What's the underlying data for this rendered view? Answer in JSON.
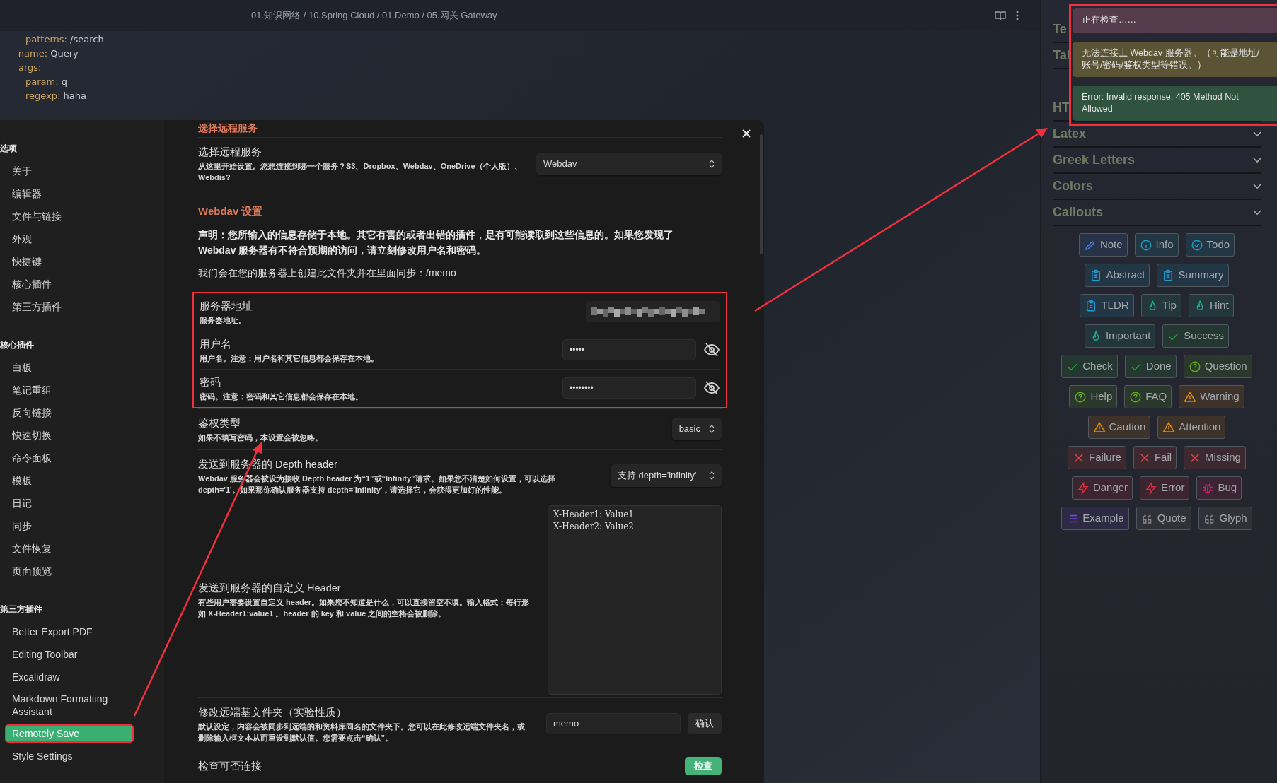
{
  "editor": {
    "breadcrumb": "01.知识网络 / 10.Spring Cloud / 01.Demo / 05.网关 Gateway",
    "code": [
      {
        "children": [
          {
            "key": "patterns:",
            "value": "/search"
          }
        ]
      },
      {
        "dash": "-",
        "key": "name:",
        "value": "Query"
      },
      {
        "key": "args:",
        "children": [
          {
            "key": "param:",
            "value": "q"
          },
          {
            "key": "regexp:",
            "value": "haha"
          }
        ]
      }
    ]
  },
  "settings_sidebar": [
    {
      "title": "选项",
      "items": [
        {
          "label": "关于",
          "selected": false,
          "highlighted": false
        },
        {
          "label": "编辑器",
          "selected": false,
          "highlighted": false
        },
        {
          "label": "文件与链接",
          "selected": false,
          "highlighted": false
        },
        {
          "label": "外观",
          "selected": false,
          "highlighted": false
        },
        {
          "label": "快捷键",
          "selected": false,
          "highlighted": false
        },
        {
          "label": "核心插件",
          "selected": false,
          "highlighted": false
        },
        {
          "label": "第三方插件",
          "selected": false,
          "highlighted": false
        }
      ]
    },
    {
      "title": "核心插件",
      "items": [
        {
          "label": "白板",
          "selected": false,
          "highlighted": false
        },
        {
          "label": "笔记重组",
          "selected": false,
          "highlighted": false
        },
        {
          "label": "反向链接",
          "selected": false,
          "highlighted": false
        },
        {
          "label": "快速切换",
          "selected": false,
          "highlighted": false
        },
        {
          "label": "命令面板",
          "selected": false,
          "highlighted": false
        },
        {
          "label": "模板",
          "selected": false,
          "highlighted": false
        },
        {
          "label": "日记",
          "selected": false,
          "highlighted": false
        },
        {
          "label": "同步",
          "selected": false,
          "highlighted": false
        },
        {
          "label": "文件恢复",
          "selected": false,
          "highlighted": false
        },
        {
          "label": "页面预览",
          "selected": false,
          "highlighted": false
        }
      ]
    },
    {
      "title": "第三方插件",
      "items": [
        {
          "label": "Better Export PDF",
          "selected": false,
          "highlighted": false
        },
        {
          "label": "Editing Toolbar",
          "selected": false,
          "highlighted": false
        },
        {
          "label": "Excalidraw",
          "selected": false,
          "highlighted": false
        },
        {
          "label": "Markdown Formatting Assistant",
          "selected": false,
          "highlighted": false
        },
        {
          "label": "Remotely Save",
          "selected": true,
          "highlighted": true
        },
        {
          "label": "Style Settings",
          "selected": false,
          "highlighted": false
        }
      ]
    }
  ],
  "settings": {
    "top_heading": "选择远程服务",
    "items": [
      {
        "kind": "setting",
        "name": "选择远程服务",
        "desc": "从这里开始设置。您想连接到哪一个服务？S3、Dropbox、Webdav、OneDrive（个人版）、Webdis?",
        "highlighted": false,
        "control": {
          "kind": "select",
          "value": "Webdav"
        }
      },
      {
        "kind": "heading",
        "text": "Webdav 设置"
      },
      {
        "kind": "paragraph",
        "bold": true,
        "text": "声明：您所输入的信息存储于本地。其它有害的或者出错的插件，是有可能读取到这些信息的。如果您发现了 Webdav 服务器有不符合预期的访问，请立刻修改用户名和密码。"
      },
      {
        "kind": "paragraph",
        "bold": false,
        "text": "我们会在您的服务器上创建此文件夹并在里面同步：/memo"
      },
      {
        "kind": "setting",
        "name": "服务器地址",
        "desc": "服务器地址。",
        "highlighted": true,
        "control": {
          "kind": "redacted"
        }
      },
      {
        "kind": "setting",
        "name": "用户名",
        "desc": "用户名。注意：用户名和其它信息都会保存在本地。",
        "highlighted": true,
        "control": {
          "kind": "password",
          "value": "•••••"
        }
      },
      {
        "kind": "setting",
        "name": "密码",
        "desc": "密码。注意：密码和其它信息都会保存在本地。",
        "highlighted": true,
        "control": {
          "kind": "password",
          "value": "••••••••"
        }
      },
      {
        "kind": "setting",
        "name": "鉴权类型",
        "desc": "如果不填写密码，本设置会被忽略。",
        "highlighted": false,
        "control": {
          "kind": "select",
          "value": "basic"
        }
      },
      {
        "kind": "setting",
        "name": "发送到服务器的 Depth header",
        "desc": "Webdav 服务器会被设为接收 Depth header 为“1”或“Infinity”请求。如果您不清楚如何设置，可以选择 depth='1'。如果那你确认服务器支持 depth='infinity'，请选择它，会获得更加好的性能。",
        "highlighted": false,
        "control": {
          "kind": "select",
          "value": "支持 depth='infinity'"
        }
      },
      {
        "kind": "setting",
        "name": "发送到服务器的自定义 Header",
        "desc": "有些用户需要设置自定义 header。如果您不知道是什么，可以直接留空不填。输入格式：每行形如 **X-Header1:value1** 。header 的 key 和 value 之间的空格会被删除。",
        "highlighted": false,
        "control": {
          "kind": "textarea",
          "lines": [
            "X-Header1: Value1",
            "X-Header2: Value2"
          ]
        }
      },
      {
        "kind": "setting",
        "name": "修改远端基文件夹（实验性质）",
        "desc": "默认设定，内容会被同步到远端的和资料库同名的文件夹下。您可以在此修改远端文件夹名，或删除输入框文本从而重设到默认值。您需要点击“确认”。",
        "highlighted": false,
        "control": {
          "kind": "input_button",
          "value": "memo",
          "button": "确认"
        }
      },
      {
        "kind": "setting",
        "name": "检查可否连接",
        "highlighted": false,
        "control": {
          "kind": "button",
          "button": "检查"
        }
      }
    ]
  },
  "right_panel": {
    "sections": [
      {
        "label": "Te"
      },
      {
        "label": "Tal"
      },
      {
        "label": "HT"
      },
      {
        "label": "Latex",
        "chevron": true
      },
      {
        "label": "Greek Letters",
        "chevron": true
      },
      {
        "label": "Colors",
        "chevron": true
      },
      {
        "label": "Callouts",
        "chevron": true
      }
    ],
    "callout_rows": [
      {
        "items": [
          {
            "label": "Note",
            "kind": "pencil",
            "color": "#3f7fe0"
          },
          {
            "label": "Info",
            "kind": "info",
            "color": "#1c9cc0"
          },
          {
            "label": "Todo",
            "kind": "todo",
            "color": "#1c9cc0"
          }
        ]
      },
      {
        "items": [
          {
            "label": "Abstract",
            "kind": "clipboard",
            "color": "#1e9ad6"
          },
          {
            "label": "Summary",
            "kind": "clipboard",
            "color": "#1e9ad6"
          }
        ]
      },
      {
        "items": [
          {
            "label": "TLDR",
            "kind": "clipboard",
            "color": "#1e9ad6"
          },
          {
            "label": "Tip",
            "kind": "flame",
            "color": "#1fa88e"
          },
          {
            "label": "Hint",
            "kind": "flame",
            "color": "#1fa88e"
          }
        ]
      },
      {
        "items": [
          {
            "label": "Important",
            "kind": "flame",
            "color": "#1fa88e"
          },
          {
            "label": "Success",
            "kind": "check",
            "color": "#23a33c"
          }
        ]
      },
      {
        "items": [
          {
            "label": "Check",
            "kind": "check",
            "color": "#23a33c"
          },
          {
            "label": "Done",
            "kind": "check",
            "color": "#23a33c"
          },
          {
            "label": "Question",
            "kind": "question",
            "color": "#5cab1c"
          }
        ]
      },
      {
        "items": [
          {
            "label": "Help",
            "kind": "question",
            "color": "#5cab1c"
          },
          {
            "label": "FAQ",
            "kind": "question",
            "color": "#5cab1c"
          },
          {
            "label": "Warning",
            "kind": "warning",
            "color": "#e0880c"
          }
        ]
      },
      {
        "items": [
          {
            "label": "Caution",
            "kind": "warning",
            "color": "#e0880c"
          },
          {
            "label": "Attention",
            "kind": "warning",
            "color": "#e0880c"
          }
        ]
      },
      {
        "items": [
          {
            "label": "Failure",
            "kind": "x",
            "color": "#e04646"
          },
          {
            "label": "Fail",
            "kind": "x",
            "color": "#e04646"
          },
          {
            "label": "Missing",
            "kind": "x",
            "color": "#e04646"
          }
        ]
      },
      {
        "items": [
          {
            "label": "Danger",
            "kind": "bolt",
            "color": "#e0283f"
          },
          {
            "label": "Error",
            "kind": "bolt",
            "color": "#e0283f"
          },
          {
            "label": "Bug",
            "kind": "bug",
            "color": "#d61f6a"
          }
        ]
      },
      {
        "items": [
          {
            "label": "Example",
            "kind": "list",
            "color": "#7a48dc"
          },
          {
            "label": "Quote",
            "kind": "quote",
            "color": "#8a8a8a"
          },
          {
            "label": "Glyph",
            "kind": "quote",
            "color": "#8a8a8a"
          }
        ]
      }
    ]
  },
  "notices": {
    "highlighted": true,
    "items": [
      {
        "text": "正在检查……",
        "color": "#553b4b"
      },
      {
        "text": "无法连接上 Webdav 服务器。（可能是地址/账号/密码/鉴权类型等错误。）",
        "color": "#5a5434"
      },
      {
        "text": "Error: Invalid response: 405 Method Not Allowed",
        "color": "#30533f"
      }
    ]
  }
}
